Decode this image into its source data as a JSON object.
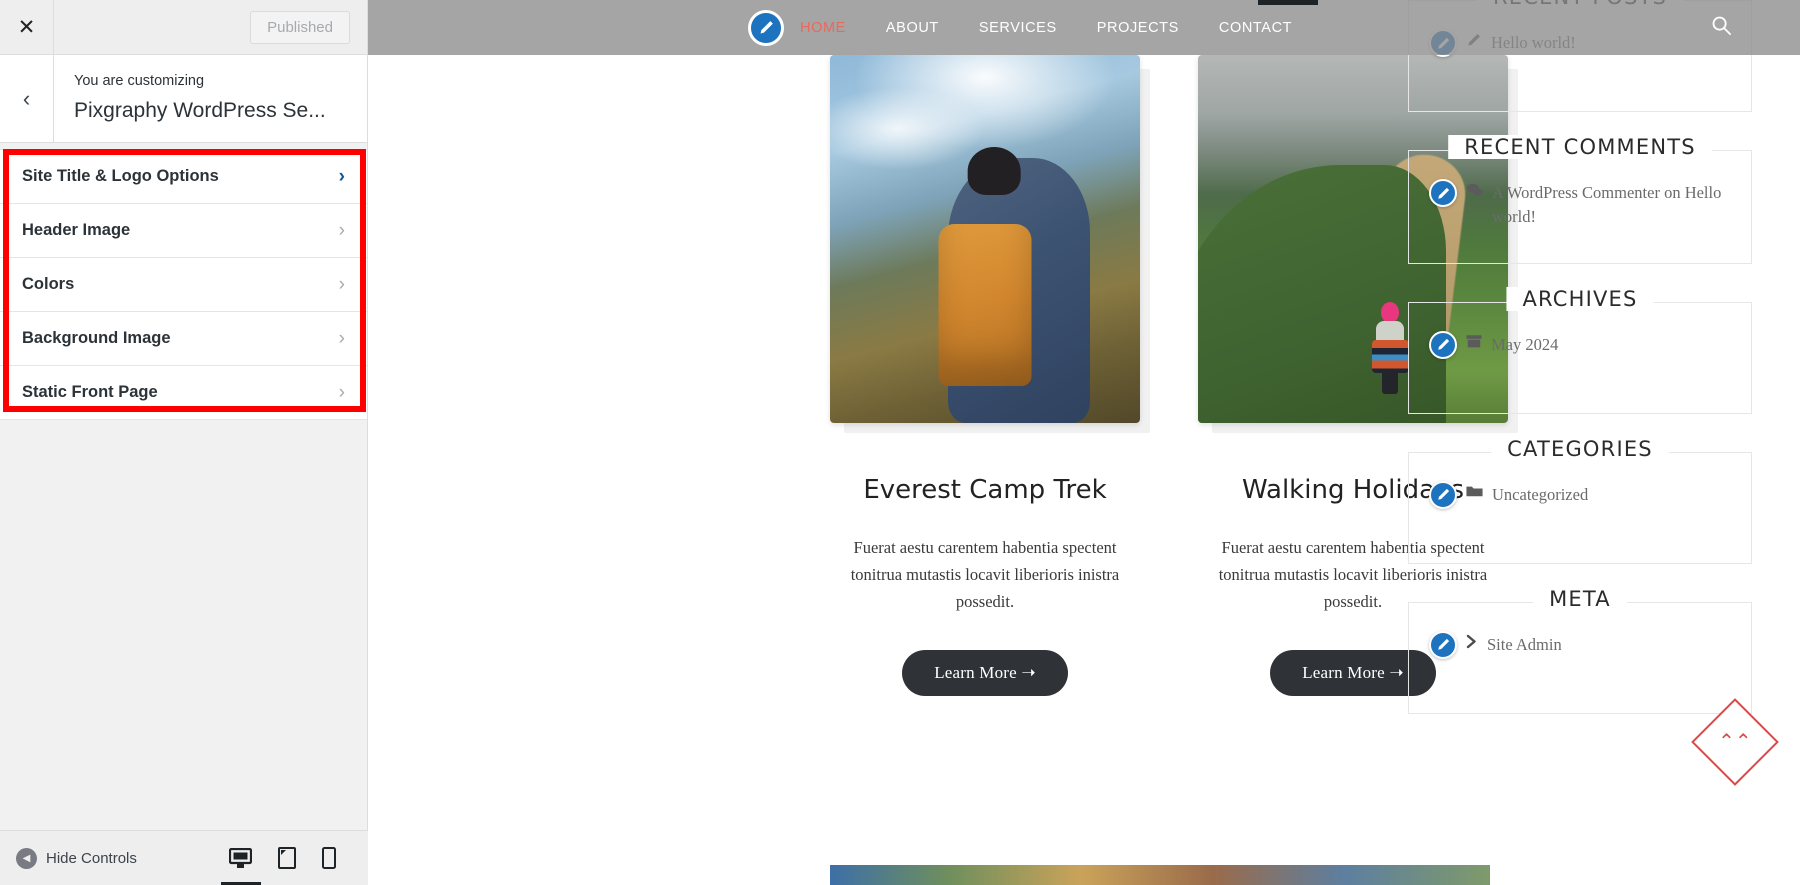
{
  "customizer": {
    "close_label": "✕",
    "publish_label": "Published",
    "back_label": "‹",
    "subtitle": "You are customizing",
    "title": "Pixgraphy WordPress Se...",
    "sections": [
      {
        "label": "Site Title & Logo Options",
        "chevron": "›",
        "highlighted": true
      },
      {
        "label": "Header Image",
        "chevron": "›",
        "highlighted": false
      },
      {
        "label": "Colors",
        "chevron": "›",
        "highlighted": false
      },
      {
        "label": "Background Image",
        "chevron": "›",
        "highlighted": false
      },
      {
        "label": "Static Front Page",
        "chevron": "›",
        "highlighted": false
      }
    ],
    "footer": {
      "hide_controls_label": "Hide Controls",
      "devices": [
        {
          "name": "desktop-preview-button",
          "icon": "desktop-icon",
          "active": true
        },
        {
          "name": "tablet-preview-button",
          "icon": "tablet-icon",
          "active": false
        },
        {
          "name": "mobile-preview-button",
          "icon": "mobile-icon",
          "active": false
        }
      ]
    },
    "highlight_color": "#ff0000",
    "accent_color": "#0b5a9e"
  },
  "site": {
    "nav": {
      "logo_icon": "pencil-edit-icon",
      "links": [
        {
          "label": "HOME",
          "current": true
        },
        {
          "label": "ABOUT",
          "current": false
        },
        {
          "label": "SERVICES",
          "current": false
        },
        {
          "label": "PROJECTS",
          "current": false
        },
        {
          "label": "CONTACT",
          "current": false
        }
      ],
      "search_icon": "search-icon",
      "active_link_color": "#e8695d"
    },
    "cards": [
      {
        "title": "Everest Camp Trek",
        "text": "Fuerat aestu carentem habentia spectent tonitrua mutastis locavit liberioris inistra possedit.",
        "button_label": "Learn More  ➝",
        "image_alt": "hiker-with-orange-backpack-in-mountains"
      },
      {
        "title": "Walking Holidays",
        "text": "Fuerat aestu carentem habentia spectent tonitrua mutastis locavit liberioris inistra possedit.",
        "button_label": "Learn More  ➝",
        "image_alt": "woman-walking-on-green-ridge-trail"
      }
    ],
    "widgets": [
      {
        "heading": "RECENT POSTS",
        "items": [
          {
            "icon": "pencil-small-icon",
            "text": "Hello world!"
          }
        ]
      },
      {
        "heading": "RECENT COMMENTS",
        "items": [
          {
            "icon": "comments-icon",
            "text": "A WordPress Commenter on Hello world!"
          }
        ]
      },
      {
        "heading": "ARCHIVES",
        "items": [
          {
            "icon": "archive-box-icon",
            "text": "May 2024"
          }
        ]
      },
      {
        "heading": "CATEGORIES",
        "items": [
          {
            "icon": "folder-icon",
            "text": "Uncategorized"
          }
        ]
      },
      {
        "heading": "META",
        "items": [
          {
            "icon": "chevron-right-icon",
            "text": "Site Admin"
          }
        ]
      }
    ],
    "scroll_top_icon": "double-chevron-up-icon",
    "scroll_top_color": "#d94a4a"
  }
}
